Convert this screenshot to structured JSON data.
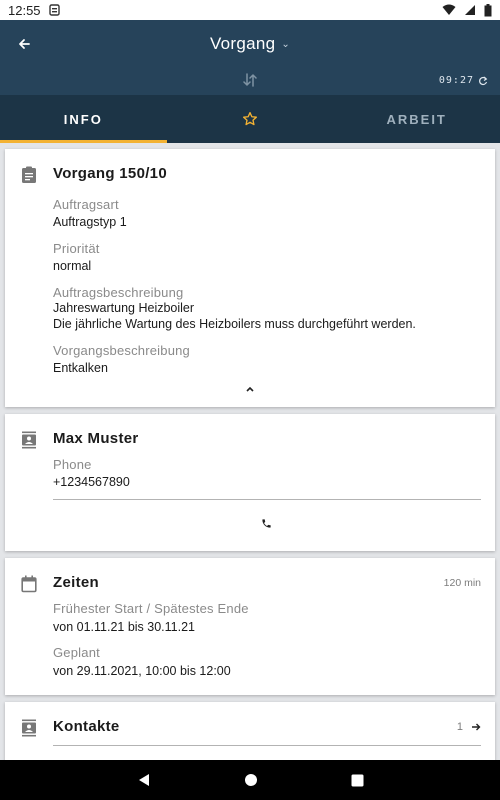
{
  "status_bar": {
    "time": "12:55"
  },
  "app_bar": {
    "title": "Vorgang",
    "clock": "09:27"
  },
  "tabs": [
    {
      "label": "INFO"
    },
    {
      "label": ""
    },
    {
      "label": "ARBEIT"
    }
  ],
  "order_card": {
    "title": "Vorgang 150/10",
    "fields": [
      {
        "label": "Auftragsart",
        "value": "Auftragstyp 1"
      },
      {
        "label": "Priorität",
        "value": "normal"
      },
      {
        "label": "Auftragsbeschreibung",
        "value": "Jahreswartung Heizboiler",
        "value2": "Die jährliche Wartung des Heizboilers muss durchgeführt werden."
      },
      {
        "label": "Vorgangsbeschreibung",
        "value": "Entkalken"
      }
    ]
  },
  "customer_card": {
    "name": "Max Muster",
    "phone_label": "Phone",
    "phone_value": "+1234567890"
  },
  "times_card": {
    "title": "Zeiten",
    "duration": "120 min",
    "fields": [
      {
        "label": "Frühester Start / Spätestes Ende",
        "value": "von 01.11.21 bis 30.11.21"
      },
      {
        "label": "Geplant",
        "value": "von 29.11.2021, 10:00 bis 12:00"
      }
    ]
  },
  "contacts_card": {
    "title": "Kontakte",
    "count": "1"
  },
  "colors": {
    "app_bar": "#26435a",
    "tab_bar": "#1c3446",
    "accent": "#f3b233",
    "background": "#e3e5e8"
  },
  "icons": [
    "back-arrow-icon",
    "chevron-down-icon",
    "sync-icon",
    "refresh-icon",
    "star-icon",
    "clipboard-icon",
    "contact-card-icon",
    "phone-icon",
    "calendar-icon",
    "chevron-up-icon",
    "arrow-right-icon"
  ]
}
